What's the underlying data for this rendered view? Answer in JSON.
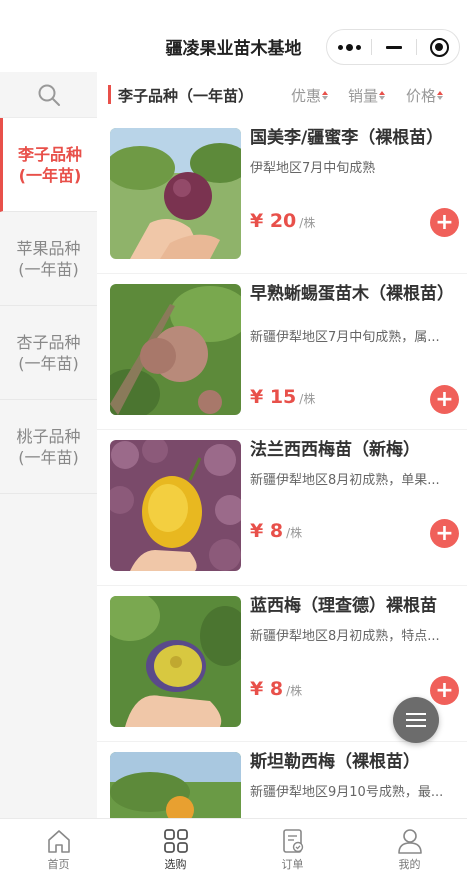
{
  "header": {
    "title": "疆凌果业苗木基地"
  },
  "sidebar": {
    "categories": [
      {
        "label": "李子品种\n(一年苗)"
      },
      {
        "label": "苹果品种\n(一年苗)"
      },
      {
        "label": "杏子品种\n(一年苗)"
      },
      {
        "label": "桃子品种\n(一年苗)"
      }
    ]
  },
  "filter": {
    "current": "李子品种（一年苗）",
    "sorts": [
      "优惠",
      "销量",
      "价格"
    ]
  },
  "products": [
    {
      "name": "国美李/疆蜜李（裸根苗）",
      "desc": "伊犁地区7月中旬成熟",
      "price": "¥ 20",
      "unit": "/株"
    },
    {
      "name": "早熟蜥蜴蛋苗木（裸根苗）",
      "desc": "新疆伊犁地区7月中旬成熟，属...",
      "price": "¥ 15",
      "unit": "/株"
    },
    {
      "name": "法兰西西梅苗（新梅）",
      "desc": "新疆伊犁地区8月初成熟，单果...",
      "price": "¥ 8",
      "unit": "/株"
    },
    {
      "name": "蓝西梅（理查德）裸根苗",
      "desc": "新疆伊犁地区8月初成熟，特点...",
      "price": "¥ 8",
      "unit": "/株"
    },
    {
      "name": "斯坦勒西梅（裸根苗）",
      "desc": "新疆伊犁地区9月10号成熟，最...",
      "price": "",
      "unit": ""
    }
  ],
  "tabbar": {
    "tabs": [
      {
        "label": "首页",
        "icon": "home-icon"
      },
      {
        "label": "选购",
        "icon": "grid-icon"
      },
      {
        "label": "订单",
        "icon": "order-icon"
      },
      {
        "label": "我的",
        "icon": "user-icon"
      }
    ]
  },
  "colors": {
    "accent": "#e8504a",
    "add_button": "#f0605a",
    "fab": "#6c6c6c"
  }
}
